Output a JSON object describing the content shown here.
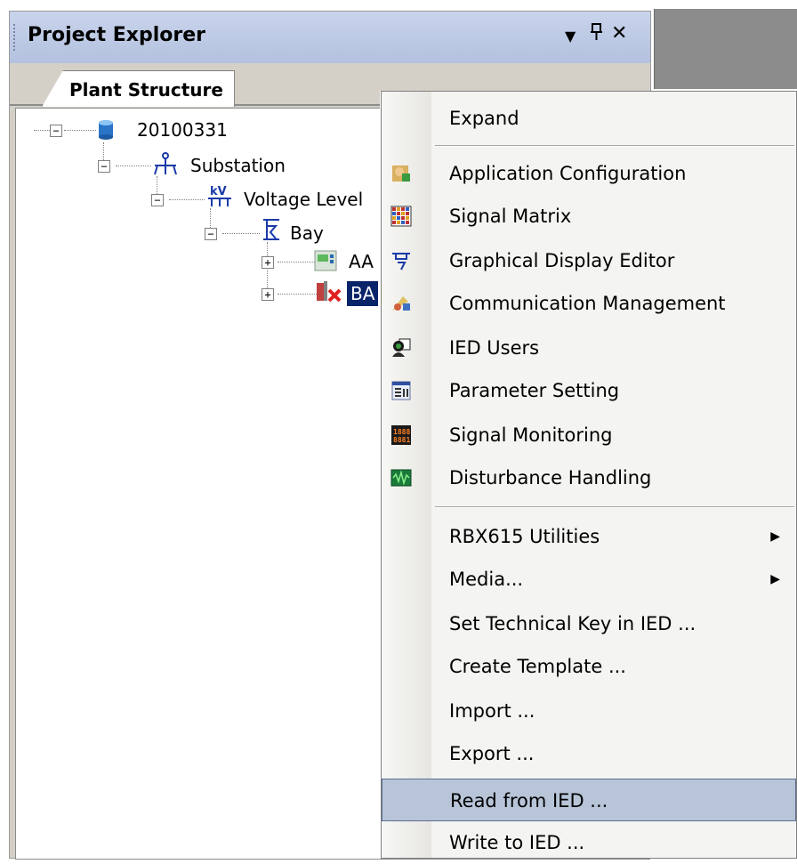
{
  "panel": {
    "title": "Project Explorer",
    "buttons": {
      "dropdown": "▼",
      "pin": "ᵖ",
      "close": "✕"
    },
    "tab_label": "Plant Structure"
  },
  "tree": {
    "root": {
      "label": "20100331",
      "icon": "database-icon",
      "toggle": "−"
    },
    "substation": {
      "label": "Substation",
      "icon": "substation-icon",
      "toggle": "−"
    },
    "voltage_level": {
      "label": "Voltage Level",
      "icon": "kv-icon",
      "toggle": "−"
    },
    "bay": {
      "label": "Bay",
      "icon": "bay-icon",
      "toggle": "−"
    },
    "ied1": {
      "label": "AA",
      "icon": "ied-icon",
      "toggle": "+"
    },
    "ied2": {
      "label": "BA",
      "icon": "ied-error-icon",
      "toggle": "+"
    }
  },
  "context_menu": {
    "items": [
      {
        "label": "Expand"
      },
      {
        "label": "Application Configuration",
        "icon": "application-configuration-icon"
      },
      {
        "label": "Signal Matrix",
        "icon": "signal-matrix-icon"
      },
      {
        "label": "Graphical Display Editor",
        "icon": "graphical-display-icon"
      },
      {
        "label": "Communication Management",
        "icon": "communication-icon"
      },
      {
        "label": "IED Users",
        "icon": "ied-users-icon"
      },
      {
        "label": "Parameter Setting",
        "icon": "parameter-setting-icon"
      },
      {
        "label": "Signal Monitoring",
        "icon": "signal-monitoring-icon"
      },
      {
        "label": "Disturbance Handling",
        "icon": "disturbance-handling-icon"
      },
      {
        "label": "RBX615 Utilities",
        "submenu": true
      },
      {
        "label": "Media...",
        "submenu": true
      },
      {
        "label": "Set Technical Key in IED ..."
      },
      {
        "label": "Create Template ..."
      },
      {
        "label": "Import ..."
      },
      {
        "label": "Export ..."
      },
      {
        "label": "Read from IED ...",
        "highlighted": true
      },
      {
        "label": "Write to IED ..."
      }
    ],
    "submenu_arrow": "▶"
  },
  "colors": {
    "titlebar": "#b8c6e4",
    "highlight": "#b8c4d8",
    "selection": "#0a246a"
  }
}
